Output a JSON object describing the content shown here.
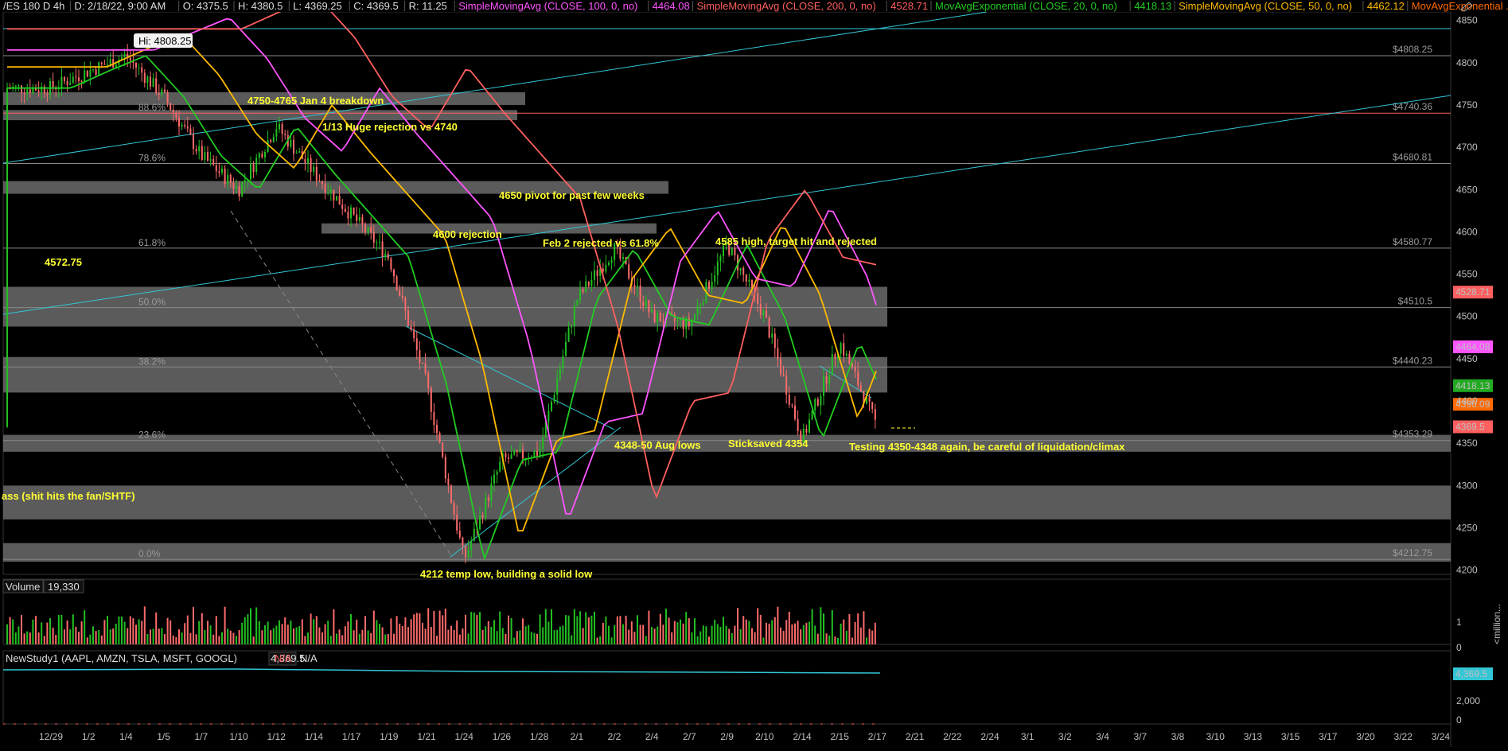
{
  "header": {
    "symbol": "/ES 180 D 4h",
    "date": "D: 2/18/22, 9:00 AM",
    "open": "O: 4375.5",
    "high": "H: 4380.5",
    "low": "L: 4369.25",
    "close": "C: 4369.5",
    "range": "R: 11.25",
    "studies": [
      {
        "label": "SimpleMovingAvg (CLOSE, 100, 0, no)",
        "value": "4464.08",
        "color": "#ff55ff"
      },
      {
        "label": "SimpleMovingAvg (CLOSE, 200, 0, no)",
        "value": "4528.71",
        "color": "#ff5f5f"
      },
      {
        "label": "MovAvgExponential (CLOSE, 20, 0, no)",
        "value": "4418.13",
        "color": "#22cc22"
      },
      {
        "label": "SimpleMovingAvg (CLOSE, 50, 0, no)",
        "value": "4462.12",
        "color": "#ffbb00"
      },
      {
        "label": "MovAvgExponential ...",
        "value": "",
        "color": "#ff6a00"
      }
    ]
  },
  "hi_callout": "Hi: 4808.25",
  "chart_data": {
    "type": "candlestick",
    "symbol": "/ES 180 D 4h",
    "ylim": [
      4195,
      4860
    ],
    "y_ticks": [
      4200,
      4250,
      4300,
      4350,
      4400,
      4450,
      4500,
      4550,
      4600,
      4650,
      4700,
      4750,
      4800,
      4850
    ],
    "x_ticks": [
      "12/29",
      "1/2",
      "1/4",
      "1/5",
      "1/7",
      "1/10",
      "1/12",
      "1/14",
      "1/17",
      "1/19",
      "1/21",
      "1/24",
      "1/26",
      "1/28",
      "2/1",
      "2/2",
      "2/4",
      "2/7",
      "2/9",
      "2/10",
      "2/14",
      "2/15",
      "2/17",
      "2/21",
      "2/22",
      "2/24",
      "3/1",
      "3/2",
      "3/4",
      "3/7",
      "3/8",
      "3/10",
      "3/13",
      "3/15",
      "3/17",
      "3/20",
      "3/22",
      "3/24"
    ],
    "price_path": [
      [
        "12/29",
        4770
      ],
      [
        "1/2",
        4790
      ],
      [
        "1/4",
        4808.25
      ],
      [
        "1/5",
        4760
      ],
      [
        "1/7",
        4690
      ],
      [
        "1/10",
        4650
      ],
      [
        "1/12",
        4725
      ],
      [
        "1/14",
        4670
      ],
      [
        "1/17",
        4620
      ],
      [
        "1/19",
        4570
      ],
      [
        "1/21",
        4420
      ],
      [
        "1/24",
        4212
      ],
      [
        "1/26",
        4330
      ],
      [
        "1/28",
        4340
      ],
      [
        "2/1",
        4520
      ],
      [
        "2/2",
        4580
      ],
      [
        "2/4",
        4500
      ],
      [
        "2/7",
        4490
      ],
      [
        "2/9",
        4585
      ],
      [
        "2/10",
        4500
      ],
      [
        "2/14",
        4354
      ],
      [
        "2/15",
        4470
      ],
      [
        "2/17",
        4369.5
      ]
    ],
    "horizontal_levels": [
      {
        "label": "$4808.25",
        "value": 4808.25
      },
      {
        "label": "$4740.36",
        "value": 4740.36,
        "color": "#ff5f5f"
      },
      {
        "label": "$4680.81",
        "value": 4680.81
      },
      {
        "label": "$4580.77",
        "value": 4580.77
      },
      {
        "label": "$4510.5",
        "value": 4510.5
      },
      {
        "label": "$4440.23",
        "value": 4440.23
      },
      {
        "label": "$4353.29",
        "value": 4353.29
      },
      {
        "label": "$4212.75",
        "value": 4212.75
      }
    ],
    "fib_labels": [
      {
        "label": "88.6%",
        "value": 4740.36
      },
      {
        "label": "78.6%",
        "value": 4680.81
      },
      {
        "label": "61.8%",
        "value": 4580.77
      },
      {
        "label": "50.0%",
        "value": 4510.5
      },
      {
        "label": "38.2%",
        "value": 4440.23
      },
      {
        "label": "23.6%",
        "value": 4353.29
      },
      {
        "label": "0.0%",
        "value": 4212.75
      }
    ],
    "zones": [
      {
        "low": 4750,
        "high": 4765
      },
      {
        "low": 4732,
        "high": 4744
      },
      {
        "low": 4645,
        "high": 4660
      },
      {
        "low": 4598,
        "high": 4610
      },
      {
        "low": 4488,
        "high": 4535
      },
      {
        "low": 4410,
        "high": 4452
      },
      {
        "low": 4340,
        "high": 4360
      },
      {
        "low": 4260,
        "high": 4300
      },
      {
        "low": 4210,
        "high": 4232
      }
    ],
    "annotations": [
      "4750-4765 Jan 4 breakdown",
      "1/13 Huge rejection vs 4740",
      "4650 pivot for past few weeks",
      "4600 rejection",
      "Feb 2 rejected vs 61.8%",
      "4585 high, target hit and rejected",
      "4572.75",
      "4348-50 Aug lows",
      "Sticksaved 4354",
      "Testing 4350-4348 again, be careful of liquidation/climax",
      "ass (shit hits the fan/SHTF)",
      "4212 temp low, building a solid low"
    ],
    "price_tags": [
      {
        "label": "4528.71",
        "value": 4528.71,
        "color": "#ff5f5f"
      },
      {
        "label": "4464.08",
        "value": 4464.08,
        "color": "#ff55ff"
      },
      {
        "label": "4418.13",
        "value": 4418.13,
        "color": "#22aa22"
      },
      {
        "label": "4396.09",
        "value": 4396.09,
        "color": "#ff6a00"
      },
      {
        "label": "4369.5",
        "value": 4369.5,
        "color": "#ff5f5f"
      }
    ],
    "volume": {
      "label": "Volume",
      "value": "19,330",
      "ticks": [
        "1",
        "0"
      ],
      "unit": "<million..."
    },
    "study": {
      "label": "NewStudy1 (AAPL, AMZN, TSLA, MSFT, GOOGL)",
      "value": "4,369.5",
      "na1": "N/A",
      "na2": "N/A",
      "tag": "4,369.5",
      "ticks": [
        "2,000",
        "0"
      ]
    }
  }
}
